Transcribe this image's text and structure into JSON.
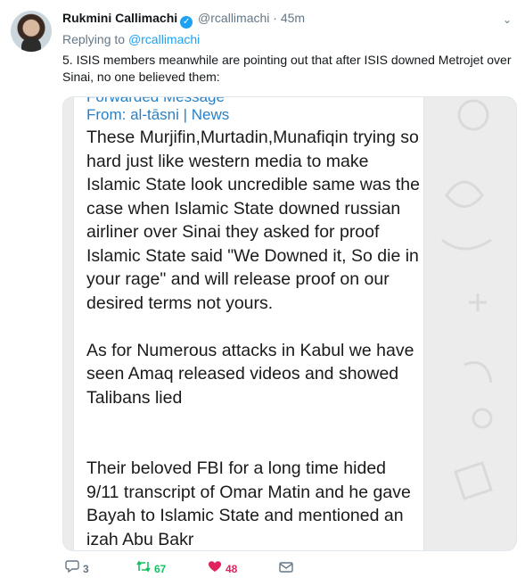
{
  "tweet": {
    "author_name": "Rukmini Callimachi",
    "handle": "@rcallimachi",
    "separator": "·",
    "time": "45m",
    "replying_prefix": "Replying to",
    "replying_to": "@rcallimachi",
    "text": "5. ISIS members meanwhile are pointing out that after ISIS downed Metrojet over Sinai, no one believed them:"
  },
  "media": {
    "forwarded_label": "Forwarded Message",
    "from_label": "From: al-tāsni | News",
    "message": "These Murjifin,Murtadin,Munafiqin trying so hard just like western media to make Islamic State look uncredible same was the case when Islamic State downed russian airliner over Sinai they asked for proof Islamic State said \"We Downed it, So die in your rage\" and will release proof on our desired terms not yours.\n\nAs for Numerous attacks in Kabul we have seen Amaq released videos and showed Talibans lied\n\n\nTheir beloved FBI for a long time hided 9/11 transcript of Omar Matin and he gave Bayah to Islamic State and mentioned an izah Abu Bakr"
  },
  "actions": {
    "reply_count": "3",
    "retweet_count": "67",
    "like_count": "48"
  },
  "icons": {
    "verified": "verified-badge-icon",
    "caret": "chevron-down-icon",
    "reply": "reply-icon",
    "retweet": "retweet-icon",
    "like": "heart-icon",
    "dm": "envelope-icon"
  },
  "colors": {
    "link": "#1da1f2",
    "retweet": "#17bf63",
    "like": "#e0245e",
    "muted": "#657786"
  }
}
